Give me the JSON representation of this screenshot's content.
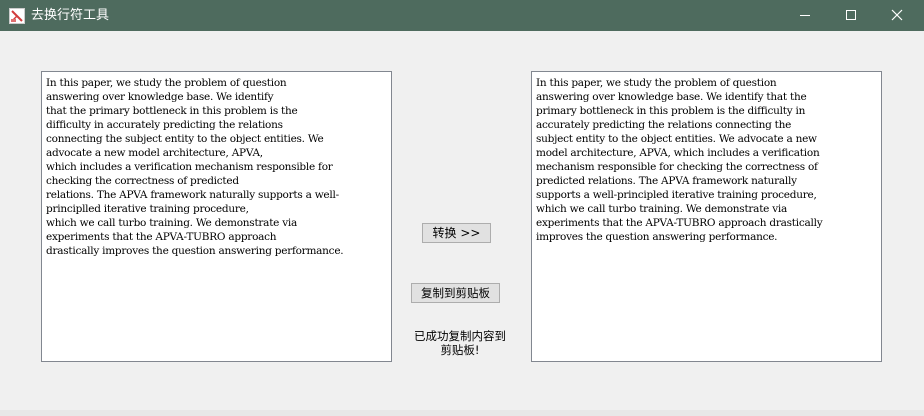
{
  "window": {
    "title": "去换行符工具",
    "controls": [
      "minimize",
      "maximize",
      "close"
    ],
    "titlebar_color": "#4e6b5e"
  },
  "input": {
    "text": "In this paper, we study the problem of question\nanswering over knowledge base. We identify\nthat the primary bottleneck in this problem is the\ndifficulty in accurately predicting the relations\nconnecting the subject entity to the object entities. We\nadvocate a new model architecture, APVA,\nwhich includes a verification mechanism responsible for\nchecking the correctness of predicted\nrelations. The APVA framework naturally supports a well-\nprinciplled iterative training procedure,\nwhich we call turbo training. We demonstrate via\nexperiments that the APVA-TUBRO approach\ndrastically improves the question answering performance."
  },
  "output": {
    "text": "In this paper, we study the problem of question\nanswering over knowledge base. We identify that the\nprimary bottleneck in this problem is the difficulty in\naccurately predicting the relations connecting the\nsubject entity to the object entities. We advocate a new\nmodel architecture, APVA, which includes a verification\nmechanism responsible for checking the correctness of\npredicted relations. The APVA framework naturally\nsupports a well-principled iterative training procedure,\nwhich we call turbo training. We demonstrate via\nexperiments that the APVA-TUBRO approach drastically\nimproves the question answering performance."
  },
  "buttons": {
    "convert_label": "转换 >>",
    "copy_label": "复制到剪贴板"
  },
  "status": {
    "line1": "已成功复制内容到",
    "line2": "剪贴板!"
  }
}
